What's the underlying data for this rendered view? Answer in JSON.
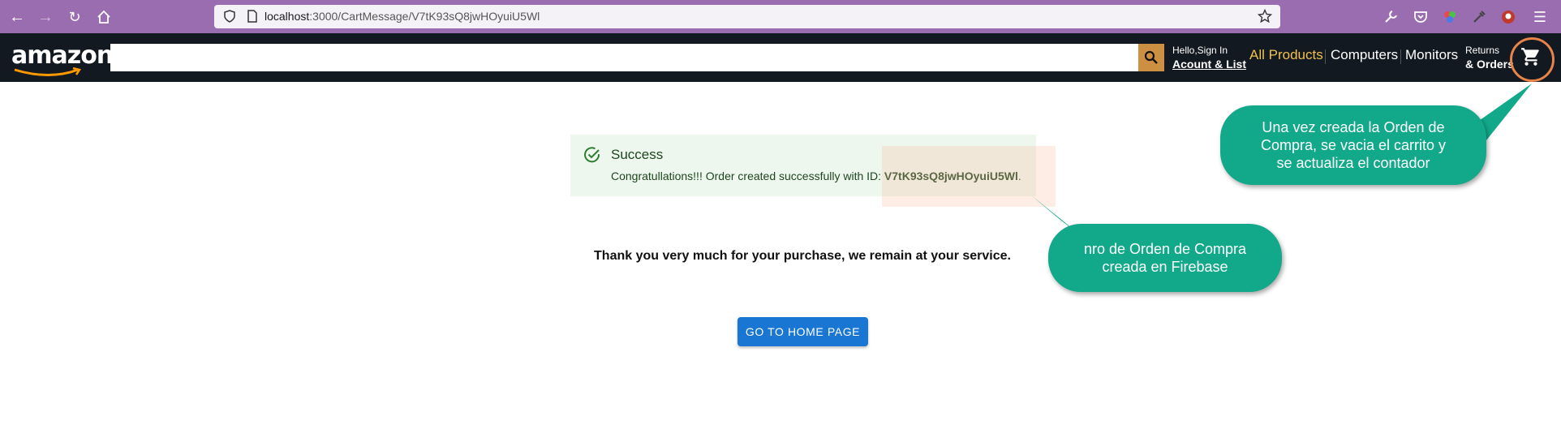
{
  "browser": {
    "url_host": "localhost",
    "url_path": ":3000/CartMessage/V7tK93sQ8jwHOyuiU5Wl"
  },
  "header": {
    "logo": "amazon",
    "search_placeholder": "",
    "signin_line1": "Hello,Sign In",
    "signin_line2": "Acount & List",
    "nav": [
      "All Products",
      "Computers",
      "Monitors"
    ],
    "returns_line1": "Returns",
    "returns_line2": "& Orders"
  },
  "alert": {
    "title": "Success",
    "message_prefix": "Congratullations!!! Order created successfully with ID: ",
    "order_id": "V7tK93sQ8jwHOyuiU5Wl",
    "message_suffix": "."
  },
  "thanks": "Thank you very much for your purchase, we remain at your service.",
  "home_button": "GO TO HOME PAGE",
  "callouts": {
    "cart_note": "Una vez creada la Orden de Compra, se vacia el carrito y se actualiza el contador",
    "order_note": "nro de Orden de Compra creada en Firebase"
  },
  "colors": {
    "browser_bar": "#9a6db0",
    "amazon_header": "#131921",
    "search_button": "#cd9042",
    "nav_active": "#f0c14b",
    "success_bg": "#edf7ed",
    "button_primary": "#1976d2",
    "callout": "#12a88a",
    "highlight_ring": "#e8844a"
  }
}
